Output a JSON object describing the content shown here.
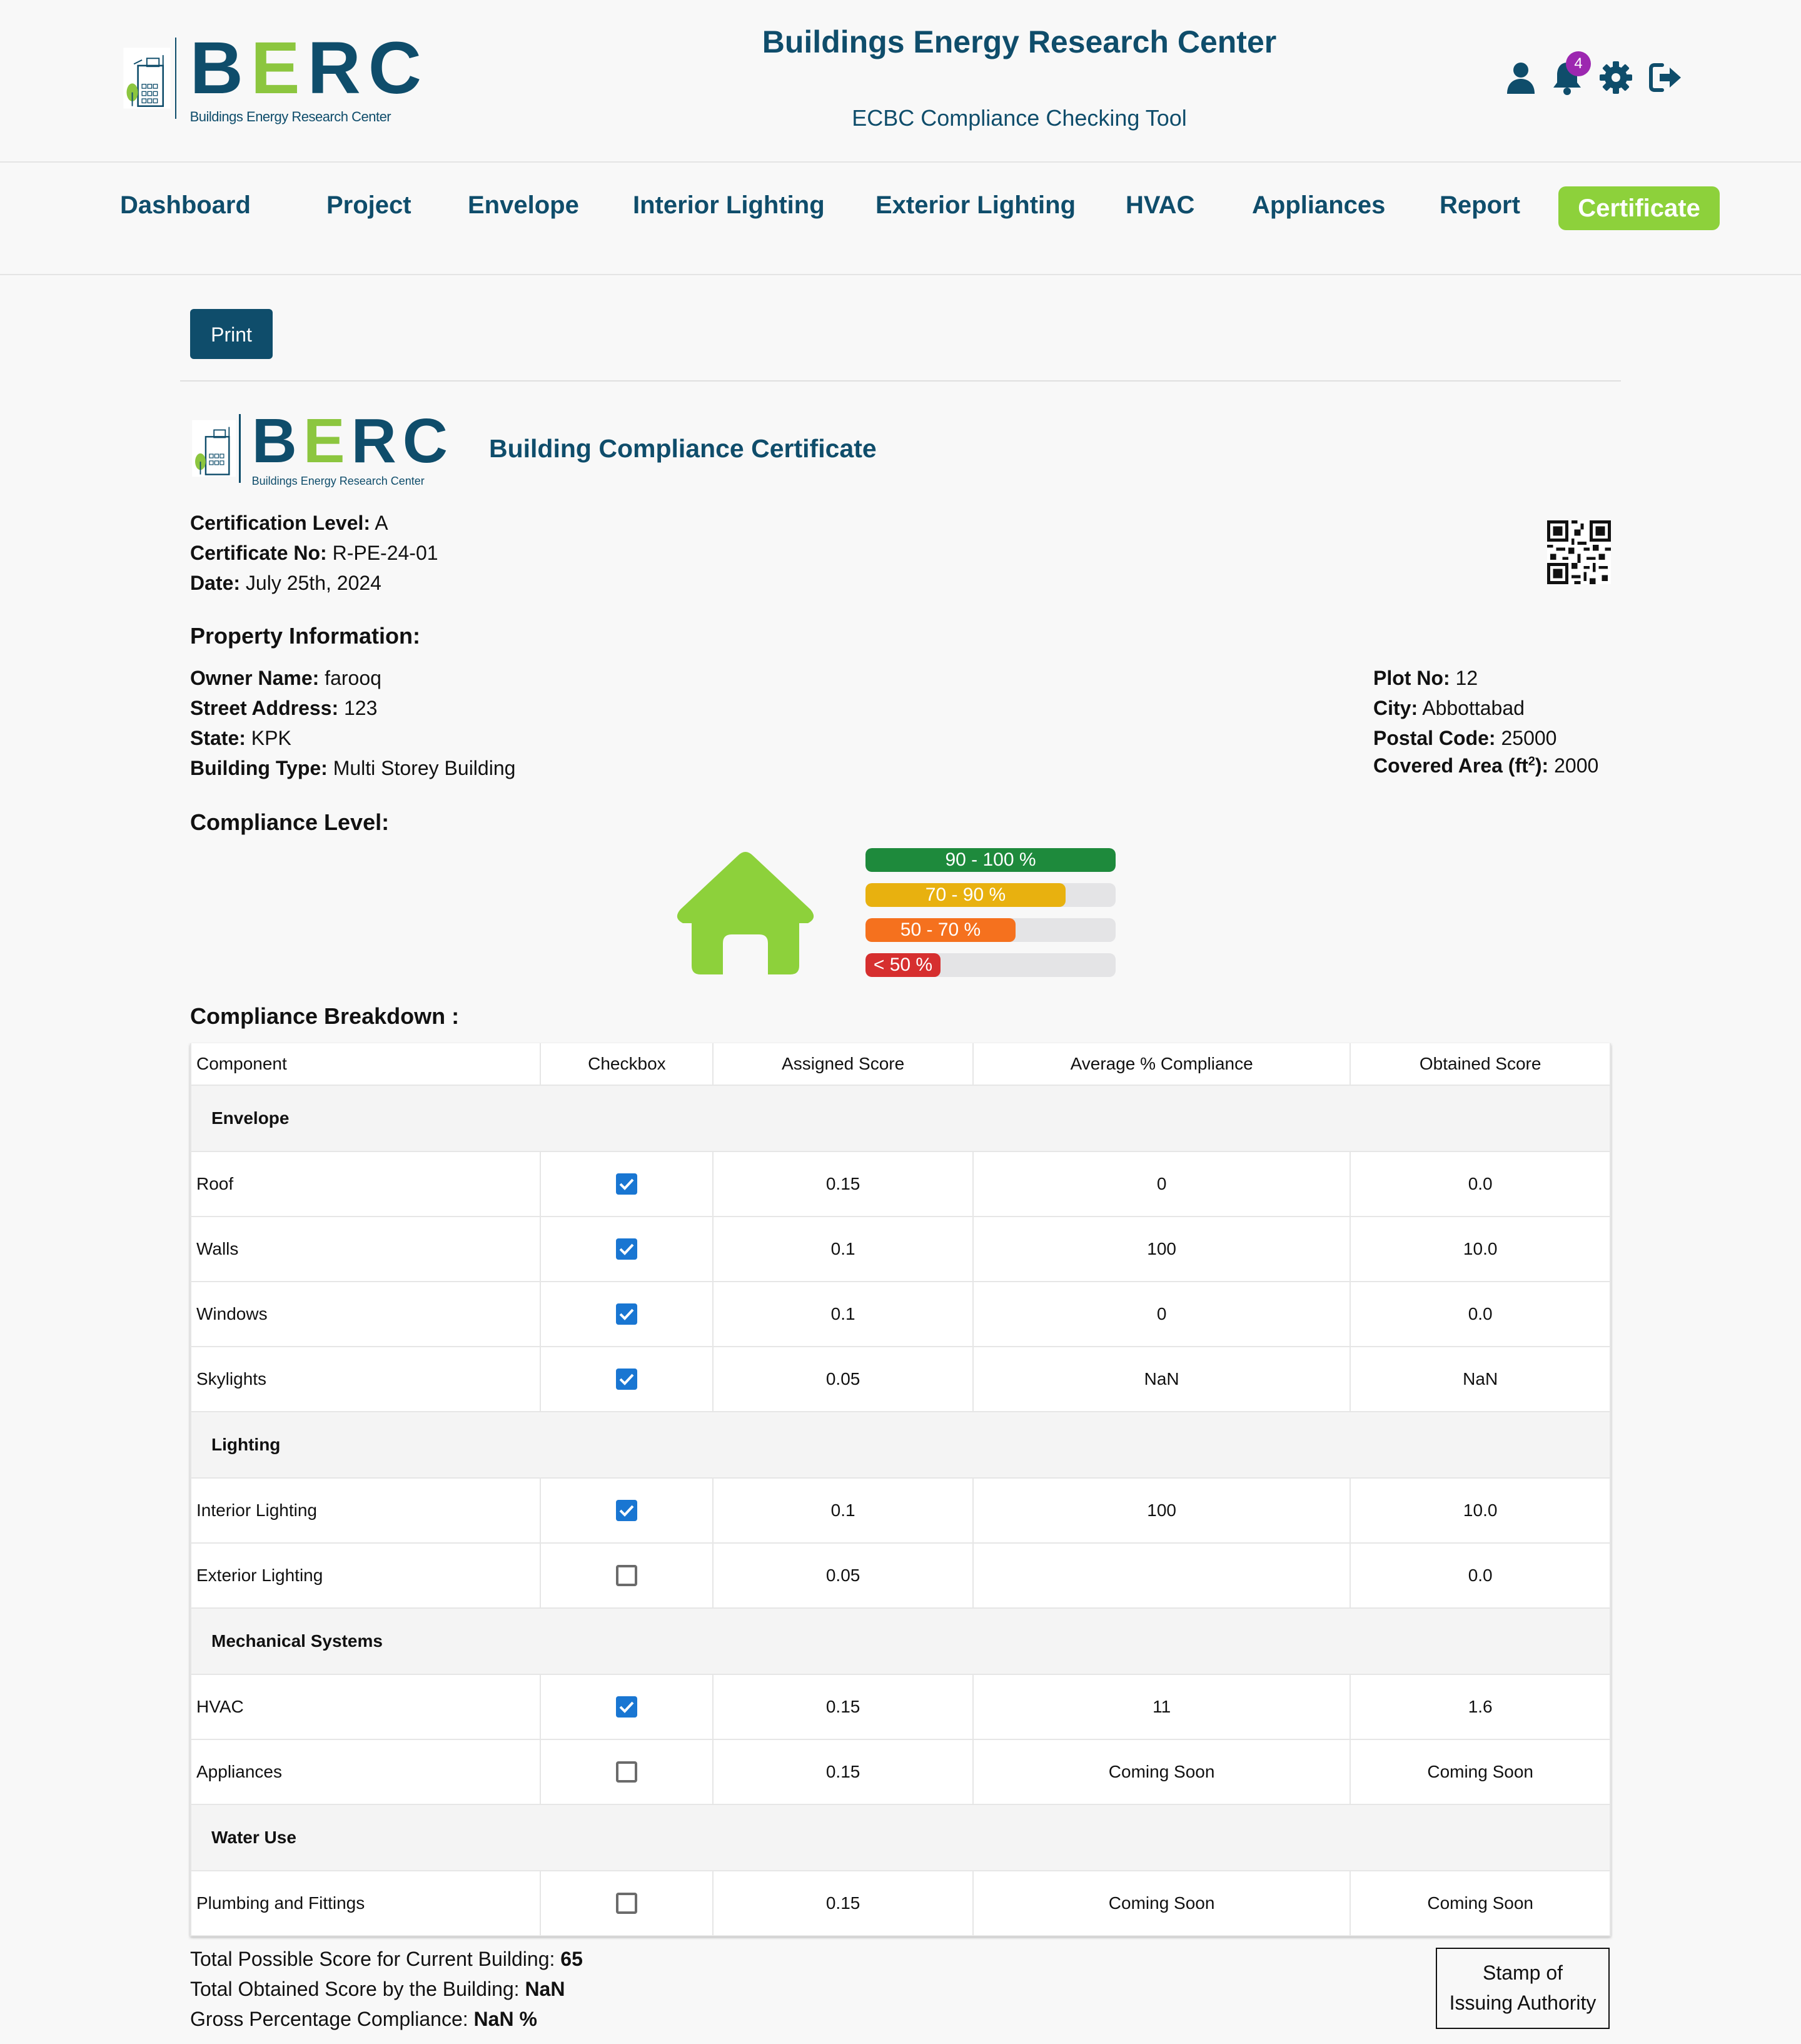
{
  "header": {
    "logo_text": "BERC",
    "logo_subtitle": "Buildings Energy Research Center",
    "title": "Buildings Energy Research Center",
    "subtitle": "ECBC Compliance Checking Tool",
    "notification_count": "4",
    "icons": [
      "user-icon",
      "bell-icon",
      "gear-icon",
      "logout-icon"
    ]
  },
  "nav": {
    "items": [
      "Dashboard",
      "Project",
      "Envelope",
      "Interior Lighting",
      "Exterior Lighting",
      "HVAC",
      "Appliances",
      "Report",
      "Certificate"
    ],
    "active": "Certificate"
  },
  "print_label": "Print",
  "certificate": {
    "title": "Building Compliance Certificate",
    "level_label": "Certification Level:",
    "level_value": "A",
    "number_label": "Certificate No:",
    "number_value": "R-PE-24-01",
    "date_label": "Date:",
    "date_value": "July 25th, 2024"
  },
  "property": {
    "heading": "Property Information:",
    "owner_label": "Owner Name:",
    "owner_value": "farooq",
    "street_label": "Street Address:",
    "street_value": "123",
    "state_label": "State:",
    "state_value": "KPK",
    "type_label": "Building Type:",
    "type_value": "Multi Storey Building",
    "plot_label": "Plot No:",
    "plot_value": "12",
    "city_label": "City:",
    "city_value": "Abbottabad",
    "postal_label": "Postal Code:",
    "postal_value": "25000",
    "area_label": "Covered Area (ft",
    "area_sup": "2",
    "area_label_end": "):",
    "area_value": "2000"
  },
  "compliance_level": {
    "heading": "Compliance Level:",
    "bars": [
      {
        "label": "90 - 100 %",
        "fill": 1.0,
        "color": "#1e8a3c"
      },
      {
        "label": "70 - 90 %",
        "fill": 0.8,
        "color": "#e8b10f"
      },
      {
        "label": "50 - 70 %",
        "fill": 0.6,
        "color": "#f5711e"
      },
      {
        "label": "< 50 %",
        "fill": 0.3,
        "color": "#d62f2f"
      }
    ],
    "house_color": "#8dd13b"
  },
  "breakdown": {
    "heading": "Compliance Breakdown :",
    "columns": [
      "Component",
      "Checkbox",
      "Assigned Score",
      "Average % Compliance",
      "Obtained Score"
    ],
    "groups": [
      {
        "name": "Envelope",
        "rows": [
          {
            "component": "Roof",
            "checked": true,
            "assigned": "0.15",
            "average": "0",
            "obtained": "0.0"
          },
          {
            "component": "Walls",
            "checked": true,
            "assigned": "0.1",
            "average": "100",
            "obtained": "10.0"
          },
          {
            "component": "Windows",
            "checked": true,
            "assigned": "0.1",
            "average": "0",
            "obtained": "0.0"
          },
          {
            "component": "Skylights",
            "checked": true,
            "assigned": "0.05",
            "average": "NaN",
            "obtained": "NaN"
          }
        ]
      },
      {
        "name": "Lighting",
        "rows": [
          {
            "component": "Interior Lighting",
            "checked": true,
            "assigned": "0.1",
            "average": "100",
            "obtained": "10.0"
          },
          {
            "component": "Exterior Lighting",
            "checked": false,
            "assigned": "0.05",
            "average": "",
            "obtained": "0.0"
          }
        ]
      },
      {
        "name": "Mechanical Systems",
        "rows": [
          {
            "component": "HVAC",
            "checked": true,
            "assigned": "0.15",
            "average": "11",
            "obtained": "1.6"
          },
          {
            "component": "Appliances",
            "checked": false,
            "assigned": "0.15",
            "average": "Coming Soon",
            "obtained": "Coming Soon"
          }
        ]
      },
      {
        "name": "Water Use",
        "rows": [
          {
            "component": "Plumbing and Fittings",
            "checked": false,
            "assigned": "0.15",
            "average": "Coming Soon",
            "obtained": "Coming Soon"
          }
        ]
      }
    ]
  },
  "totals": {
    "possible_label": "Total Possible Score for Current Building:",
    "possible_value": "65",
    "obtained_label": "Total Obtained Score by the Building:",
    "obtained_value": "NaN",
    "gross_label": "Gross Percentage Compliance:",
    "gross_value": "NaN %"
  },
  "stamp": {
    "line1": "Stamp of",
    "line2": "Issuing Authority"
  }
}
